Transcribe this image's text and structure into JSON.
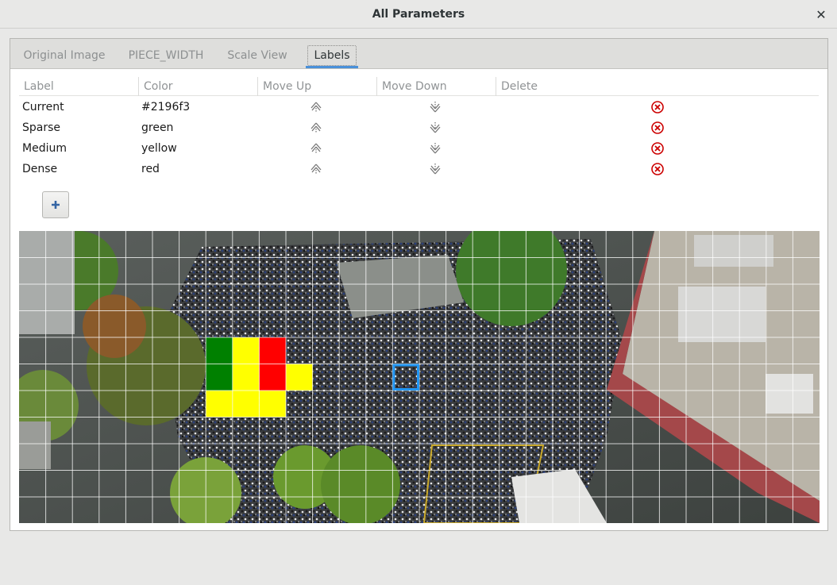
{
  "window": {
    "title": "All Parameters"
  },
  "tabs": [
    {
      "label": "Original Image",
      "active": false
    },
    {
      "label": "PIECE_WIDTH",
      "active": false
    },
    {
      "label": "Scale View",
      "active": false
    },
    {
      "label": "Labels",
      "active": true
    }
  ],
  "table": {
    "headers": [
      "Label",
      "Color",
      "Move Up",
      "Move Down",
      "Delete"
    ],
    "rows": [
      {
        "label": "Current",
        "color": "#2196f3"
      },
      {
        "label": "Sparse",
        "color": "green"
      },
      {
        "label": "Medium",
        "color": "yellow"
      },
      {
        "label": "Dense",
        "color": "red"
      }
    ]
  },
  "add_button": {
    "icon": "plus-icon"
  },
  "grid": {
    "columns": 30,
    "rows": 11,
    "highlighted_cells": [
      {
        "col": 7,
        "row": 4,
        "color": "green"
      },
      {
        "col": 8,
        "row": 4,
        "color": "yellow"
      },
      {
        "col": 9,
        "row": 4,
        "color": "red"
      },
      {
        "col": 7,
        "row": 5,
        "color": "green"
      },
      {
        "col": 8,
        "row": 5,
        "color": "yellow"
      },
      {
        "col": 9,
        "row": 5,
        "color": "red"
      },
      {
        "col": 10,
        "row": 5,
        "color": "yellow"
      },
      {
        "col": 7,
        "row": 6,
        "color": "yellow"
      },
      {
        "col": 8,
        "row": 6,
        "color": "yellow"
      },
      {
        "col": 9,
        "row": 6,
        "color": "yellow"
      }
    ],
    "current_cell": {
      "col": 14,
      "row": 5,
      "color": "#2196f3"
    }
  },
  "colors": {
    "accent": "#4a90d9",
    "delete_icon": "#cc0000",
    "current": "#2196f3",
    "sparse": "#008000",
    "medium": "#ffff00",
    "dense": "#ff0000"
  }
}
